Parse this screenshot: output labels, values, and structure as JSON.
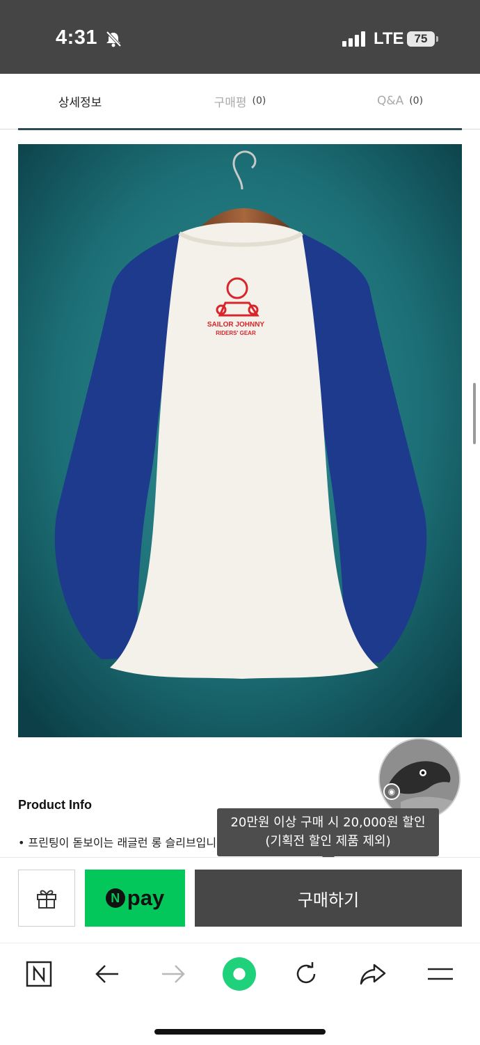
{
  "status_bar": {
    "time": "4:31",
    "network": "LTE",
    "battery": "75"
  },
  "tabs": [
    {
      "label": "상세정보",
      "count": ""
    },
    {
      "label": "구매평",
      "count": "(0)"
    },
    {
      "label": "Q&A",
      "count": "(0)"
    }
  ],
  "product_image": {
    "print_line1": "SAILOR JOHNNY",
    "print_line2": "RIDERS' GEAR"
  },
  "product_info": {
    "title": "Product Info",
    "bullet": "• 프린팅이 돋보이는 래글런 롱 슬리브입니다."
  },
  "tooltip": {
    "line1": "20만원 이상 구매 시 20,000원 할인",
    "line2": "(기획전 할인 제품 제외)"
  },
  "buy_bar": {
    "npay_mark": "N",
    "npay_label": "pay",
    "purchase_label": "구매하기"
  },
  "colors": {
    "status_bar_bg": "#454545",
    "npay_green": "#03c75a",
    "purchase_bg": "#474747",
    "browser_accent": "#1ed17a"
  }
}
